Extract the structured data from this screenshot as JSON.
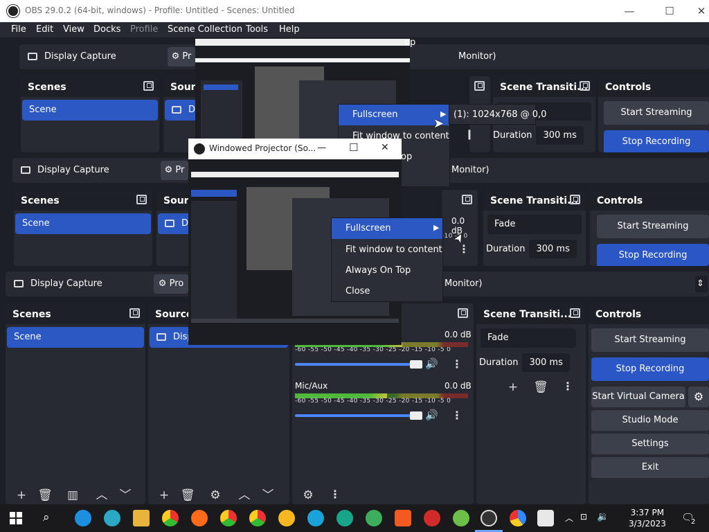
{
  "window": {
    "title": "OBS 29.0.2 (64-bit, windows) - Profile: Untitled - Scenes: Untitled",
    "minimize": "—",
    "maximize": "☐",
    "close": "✕"
  },
  "menu": [
    "File",
    "Edit",
    "View",
    "Docks",
    "Profile",
    "Scene Collection",
    "Tools",
    "Help"
  ],
  "scenebar": {
    "source_name": "Display Capture",
    "properties": "Properties",
    "monitor": "Monitor)",
    "properties_short": "Pr",
    "properties_short2": "Pro"
  },
  "docks": {
    "scenes": "Scenes",
    "sources": "Sources",
    "sources_short": "Sourc",
    "sources_mid": "Source",
    "transitions": "Scene Transiti...",
    "controls": "Controls"
  },
  "scene_item": "Scene",
  "source_item": "Display Capture",
  "source_short": "D",
  "source_mid": "Disp",
  "transition": {
    "type": "Fade",
    "duration_label": "Duration",
    "duration_value": "300 ms"
  },
  "controls": {
    "start_streaming": "Start Streaming",
    "stop_recording": "Stop Recording",
    "start_virtual_camera": "Start Virtual Camera",
    "studio_mode": "Studio Mode",
    "settings": "Settings",
    "exit": "Exit"
  },
  "mixer": {
    "desktop_db": "0.0 dB",
    "mic_name": "Mic/Aux",
    "mic_db": "0.0 dB",
    "scale": "-60 -55 -50 -45 -40 -35 -30 -25 -20 -15 -10 -5 0",
    "peek_scale": "-10  -5  0",
    "desktop_level": 0.62,
    "mic_level": 0.53
  },
  "context_menu": {
    "items": [
      "Fullscreen",
      "Fit window to content",
      "Always On Top",
      "Close"
    ],
    "submenu": "(1): 1024x768 @ 0,0",
    "top_tail": "op",
    "top_tail2": "op"
  },
  "projector": {
    "title": "Windowed Projector (So...",
    "minimize": "—",
    "maximize": "☐",
    "close": "✕"
  },
  "clock": {
    "time": "3:37 PM",
    "date": "3/3/2023"
  },
  "notifications": "2",
  "colors": {
    "accent": "#2c58c4",
    "panel": "#272a33",
    "background": "#1d1f26"
  }
}
